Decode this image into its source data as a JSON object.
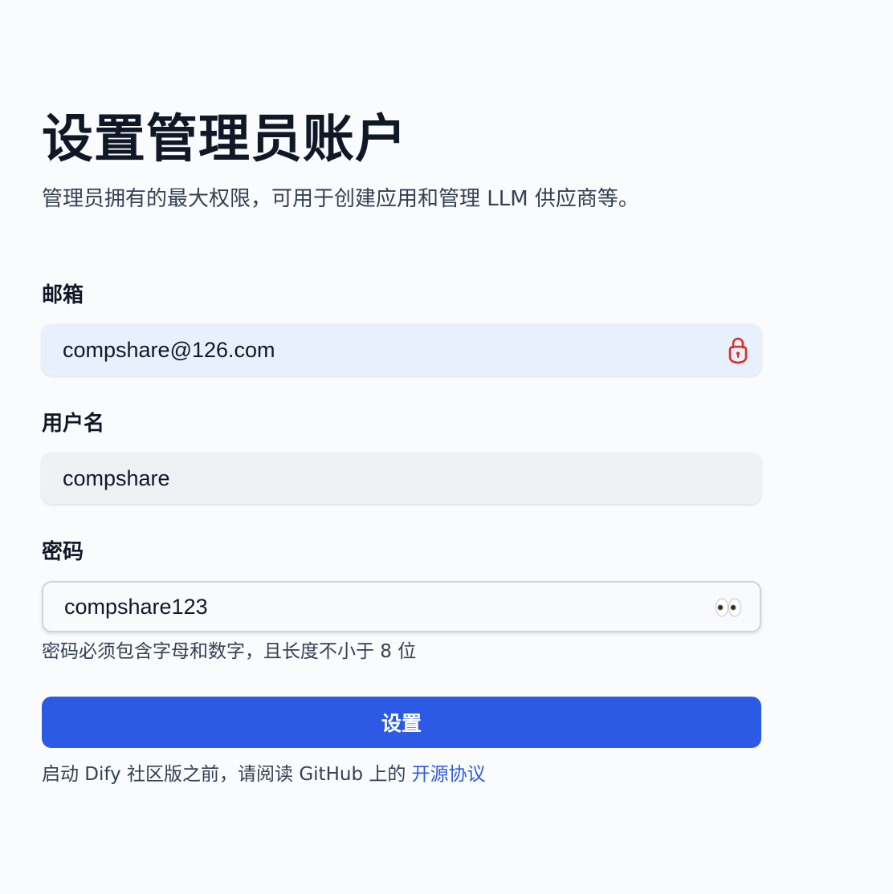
{
  "header": {
    "title": "设置管理员账户",
    "subtitle": "管理员拥有的最大权限，可用于创建应用和管理 LLM 供应商等。"
  },
  "form": {
    "email": {
      "label": "邮箱",
      "value": "compshare@126.com",
      "icon": "lock-icon"
    },
    "username": {
      "label": "用户名",
      "value": "compshare"
    },
    "password": {
      "label": "密码",
      "value": "compshare123",
      "icon": "eyes-icon",
      "hint": "密码必须包含字母和数字，且长度不小于 8 位"
    },
    "submit_label": "设置"
  },
  "footer": {
    "text": "启动 Dify 社区版之前，请阅读 GitHub 上的 ",
    "link_label": "开源协议"
  },
  "colors": {
    "primary": "#2d5ae5",
    "email_bg": "#e8f0fe",
    "lock_icon": "#d93025"
  }
}
